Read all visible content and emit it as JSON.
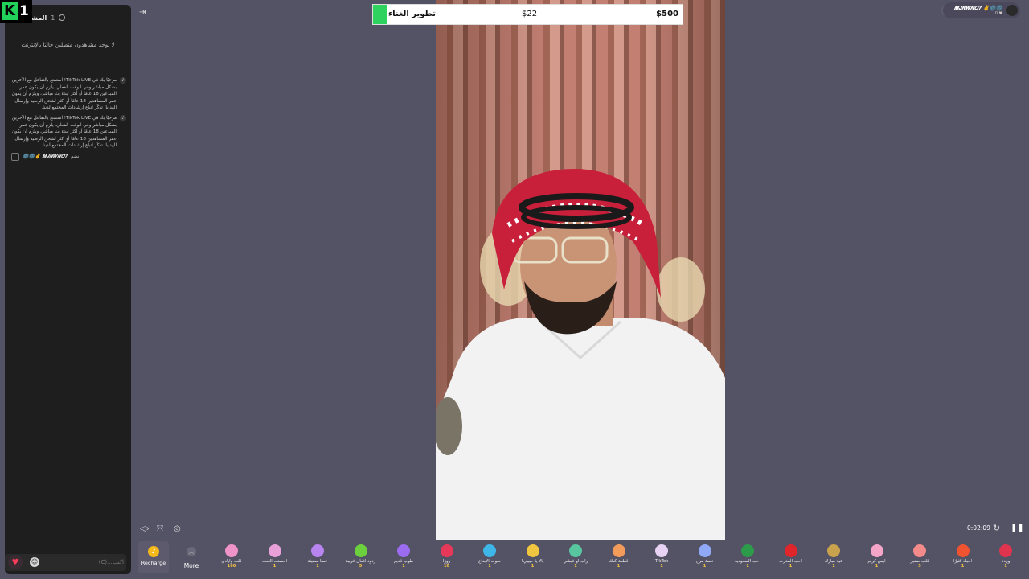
{
  "viewers": {
    "title": "المشاهدون",
    "count": "1",
    "empty_text": "لا يوجد مشاهدون متصلين حاليًا بالإنترنت"
  },
  "chat": {
    "messages": [
      {
        "text": "مرحبًا بك في TikTok LIVE! استمتع بالتفاعل مع الآخرين بشكل مباشر وفي الوقت الفعلي. يلزم أن يكون عمر المبدعين 18 عامًا أو أكثر لبدء بث مباشر، ويلزم أن يكون عمر المشاهدين 18 عامًا أو أكثر لشحن الرصيد وإرسال الهدايا. تذكّر اتباع إرشادات المجتمع لدينا."
      },
      {
        "text": "مرحبًا بك في TikTok LIVE! استمتع بالتفاعل مع الآخرين بشكل مباشر وفي الوقت الفعلي. يلزم أن يكون عمر المبدعين 18 عامًا أو أكثر لبدء بث مباشر، ويلزم أن يكون عمر المشاهدين 18 عامًا أو أكثر لشحن الرصيد وإرسال الهدايا. تذكّر اتباع إرشادات المجتمع لدينا."
      }
    ],
    "join": {
      "user": "𝑴𝑱𝑵𝑾𝑵𝑶𝟕 ✌️🌚🌚",
      "action": "انضم"
    },
    "input_placeholder": "اكتب...(C)"
  },
  "logo": {
    "text": "1"
  },
  "goal": {
    "label": "تطوير الغناء",
    "current": "$22",
    "target": "$500",
    "progress_pct": 4.4
  },
  "host": {
    "name": "𝑴𝑱𝑵𝑾𝑵𝑶𝟕 ✌️🌚🌚",
    "sub": "0 ♥"
  },
  "stream": {
    "timer": "0:02:09"
  },
  "gift_bar": {
    "recharge_label": "Recharge",
    "more_label": "More",
    "gifts": [
      {
        "name": "قلب وأيادي",
        "price": "100",
        "color": "#f093c9"
      },
      {
        "name": "أحسنت اللعب",
        "price": "1",
        "color": "#e8a0d8"
      },
      {
        "name": "عصا مضيئة",
        "price": "1",
        "color": "#b884f0"
      },
      {
        "name": "ردود أفعال غريبة",
        "price": "5",
        "color": "#6ccf3d"
      },
      {
        "name": "طوب قديم",
        "price": "1",
        "color": "#9c6cf0"
      },
      {
        "name": "روزا",
        "price": "10",
        "color": "#e8385a"
      },
      {
        "name": "صوت الإبداع",
        "price": "1",
        "color": "#3fb6e8"
      },
      {
        "name": "يالا يا حبيبي!",
        "price": "1",
        "color": "#f0c53f"
      },
      {
        "name": "راب أو غيشي",
        "price": "1",
        "color": "#58c7a0"
      },
      {
        "name": "قطعة كعك",
        "price": "1",
        "color": "#f29b5a"
      },
      {
        "name": "TikTok",
        "price": "1",
        "color": "#e8d3f5"
      },
      {
        "name": "نغمة مرح",
        "price": "1",
        "color": "#8fa8f7"
      },
      {
        "name": "أحب السعودية",
        "price": "1",
        "color": "#2c9c4a"
      },
      {
        "name": "أحب المغرب",
        "price": "1",
        "color": "#e0262b"
      },
      {
        "name": "عيد مبارك",
        "price": "1",
        "color": "#c9a24e"
      },
      {
        "name": "آيس كريم",
        "price": "1",
        "color": "#f5a6c8"
      },
      {
        "name": "قلب صغير",
        "price": "5",
        "color": "#f48a8a"
      },
      {
        "name": "أحبك كثيرًا",
        "price": "1",
        "color": "#f0532f"
      },
      {
        "name": "وردة",
        "price": "1",
        "color": "#e0344e"
      }
    ]
  }
}
